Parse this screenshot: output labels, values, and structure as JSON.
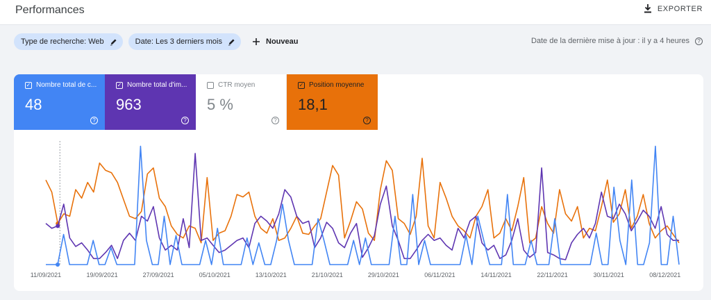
{
  "header": {
    "title": "Performances",
    "export_label": "EXPORTER"
  },
  "filters": {
    "chips": [
      {
        "label": "Type de recherche: Web"
      },
      {
        "label": "Date: Les 3 derniers mois"
      }
    ],
    "new_label": "Nouveau",
    "updated_text": "Date de la dernière mise à jour : il y a 4 heures"
  },
  "metrics": [
    {
      "label": "Nombre total de c...",
      "value": "48",
      "checked": true,
      "color": "#4285f4"
    },
    {
      "label": "Nombre total d'im...",
      "value": "963",
      "checked": true,
      "color": "#5e35b1"
    },
    {
      "label": "CTR moyen",
      "value": "5 %",
      "checked": false,
      "color": "#ffffff"
    },
    {
      "label": "Position moyenne",
      "value": "18,1",
      "checked": true,
      "color": "#e8710a"
    }
  ],
  "chart_data": {
    "type": "line",
    "x_tick_labels": [
      "11/09/2021",
      "19/09/2021",
      "27/09/2021",
      "05/10/2021",
      "13/10/2021",
      "21/10/2021",
      "29/10/2021",
      "06/11/2021",
      "14/11/2021",
      "22/11/2021",
      "30/11/2021",
      "08/12/2021"
    ],
    "x_start": "11/09/2021",
    "x_end": "10/12/2021",
    "hover_date": "13/09/2021",
    "grid": false,
    "legend": "none",
    "series": [
      {
        "color": "#e8710a",
        "values": [
          0.7,
          0.6,
          0.34,
          0.42,
          0.4,
          0.62,
          0.55,
          0.68,
          0.6,
          0.84,
          0.78,
          0.76,
          0.68,
          0.54,
          0.4,
          0.38,
          0.44,
          0.75,
          0.8,
          0.55,
          0.48,
          0.32,
          0.25,
          0.22,
          0.32,
          0.3,
          0.18,
          0.72,
          0.2,
          0.26,
          0.28,
          0.4,
          0.58,
          0.56,
          0.6,
          0.4,
          0.3,
          0.26,
          0.38,
          0.2,
          0.22,
          0.3,
          0.4,
          0.26,
          0.25,
          0.32,
          0.38,
          0.6,
          0.82,
          0.74,
          0.22,
          0.36,
          0.52,
          0.46,
          0.26,
          0.2,
          0.62,
          0.86,
          0.78,
          0.38,
          0.34,
          0.25,
          0.4,
          0.88,
          0.32,
          0.22,
          0.68,
          0.55,
          0.4,
          0.32,
          0.28,
          0.22,
          0.4,
          0.48,
          0.62,
          0.22,
          0.26,
          0.38,
          0.28,
          0.48,
          0.72,
          0.18,
          0.22,
          0.48,
          0.34,
          0.26,
          0.62,
          0.42,
          0.36,
          0.48,
          0.22,
          0.3,
          0.28,
          0.48,
          0.7,
          0.35,
          0.42,
          0.62,
          0.3,
          0.4,
          0.58,
          0.34,
          0.22,
          0.28,
          0.32,
          0.25,
          0.18
        ]
      },
      {
        "color": "#5e35b1",
        "values": [
          0.34,
          0.3,
          0.32,
          0.5,
          0.22,
          0.15,
          0.18,
          0.12,
          0.05,
          0.05,
          0.1,
          0.16,
          0.05,
          0.2,
          0.26,
          0.2,
          0.4,
          0.36,
          0.48,
          0.22,
          0.12,
          0.16,
          0.12,
          0.38,
          0.14,
          0.92,
          0.2,
          0.22,
          0.16,
          0.1,
          0.12,
          0.16,
          0.2,
          0.22,
          0.14,
          0.34,
          0.4,
          0.36,
          0.3,
          0.42,
          0.62,
          0.56,
          0.4,
          0.34,
          0.36,
          0.14,
          0.22,
          0.35,
          0.3,
          0.18,
          0.14,
          0.26,
          0.34,
          0.06,
          0.14,
          0.24,
          0.5,
          0.65,
          0.32,
          0.2,
          0.05,
          0.05,
          0.12,
          0.2,
          0.25,
          0.2,
          0.22,
          0.16,
          0.12,
          0.3,
          0.22,
          0.36,
          0.4,
          0.18,
          0.12,
          0.16,
          0.05,
          0.08,
          0.2,
          0.38,
          0.12,
          0.06,
          0.1,
          0.8,
          0.1,
          0.08,
          0.05,
          0.04,
          0.18,
          0.25,
          0.3,
          0.22,
          0.34,
          0.6,
          0.4,
          0.38,
          0.5,
          0.42,
          0.28,
          0.36,
          0.45,
          0.4,
          0.3,
          0.48,
          0.25,
          0.2,
          0.2
        ]
      },
      {
        "color": "#4285f4",
        "values": [
          0,
          0,
          0,
          0.25,
          0,
          0,
          0,
          0,
          0.2,
          0,
          0,
          0.14,
          0,
          0,
          0,
          0,
          0.98,
          0.2,
          0,
          0,
          0.4,
          0,
          0.24,
          0,
          0,
          0,
          0,
          0.2,
          0,
          0.3,
          0,
          0,
          0,
          0,
          0.22,
          0,
          0.18,
          0,
          0,
          0.2,
          0.5,
          0.2,
          0,
          0,
          0,
          0,
          0.38,
          0.2,
          0,
          0,
          0,
          0,
          0.2,
          0,
          0.22,
          0,
          0,
          0,
          0,
          0.4,
          0,
          0,
          0.58,
          0,
          0.2,
          0,
          0,
          0,
          0,
          0,
          0,
          0.24,
          0,
          0.4,
          0.2,
          0,
          0,
          0,
          0.58,
          0,
          0,
          0,
          0.2,
          0,
          0,
          0,
          0.38,
          0,
          0,
          0,
          0,
          0,
          0,
          0.26,
          0,
          0,
          0.64,
          0.2,
          0,
          0.7,
          0,
          0,
          0.18,
          0.98,
          0,
          0,
          0.4,
          0
        ]
      }
    ]
  }
}
